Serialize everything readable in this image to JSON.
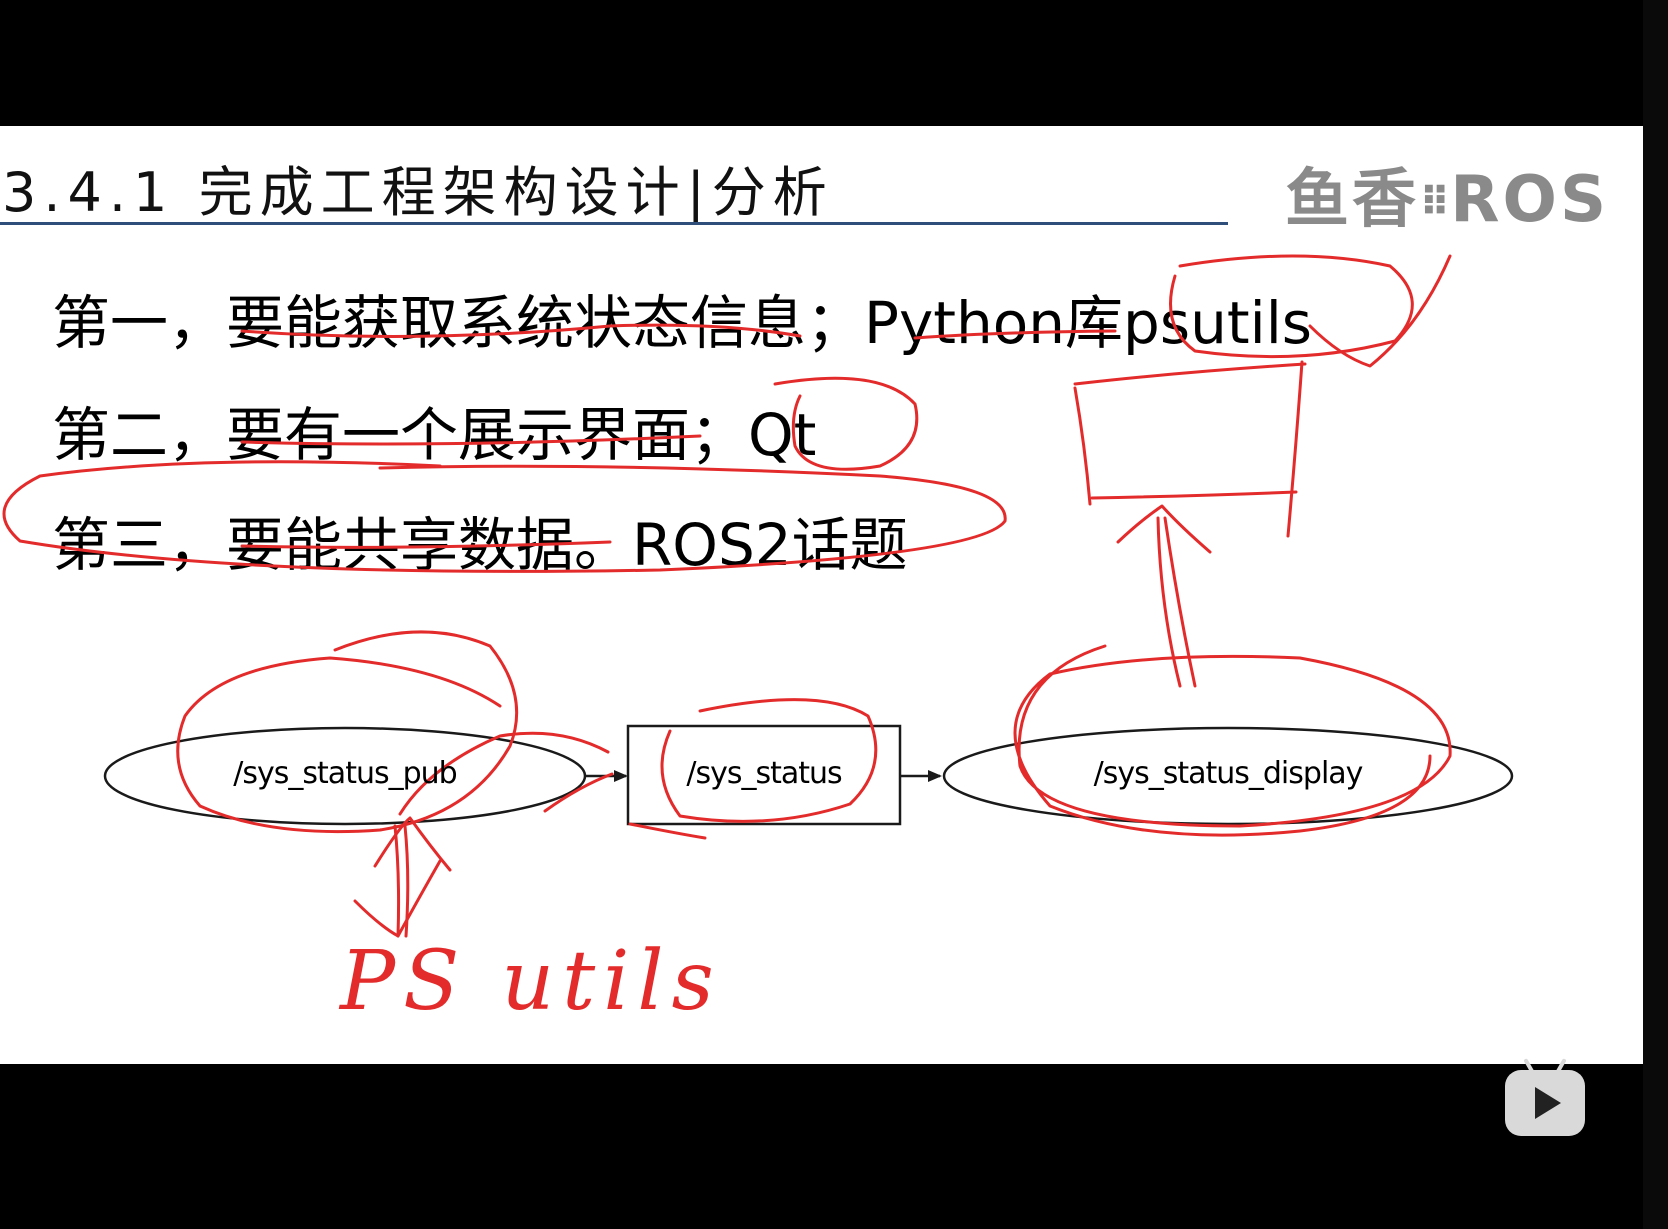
{
  "slide": {
    "title": "3.4.1 完成工程架构设计|分析",
    "logo_text": "鱼香",
    "logo_dots": "⠿",
    "logo_suffix": "ROS",
    "bullets": [
      "第一，要能获取系统状态信息；Python库psutils",
      "第二，要有一个展示界面；Qt",
      "第三，要能共享数据。ROS2话题"
    ]
  },
  "graph": {
    "publisher": "/sys_status_pub",
    "topic": "/sys_status",
    "subscriber": "/sys_status_display"
  },
  "annotation": {
    "handwritten": "PS utils"
  },
  "player": {
    "play_icon": "bilibili-tv-play-icon"
  },
  "colors": {
    "ink": "#e32b2b",
    "title_rule": "#2f4f7a",
    "background": "#000000",
    "slide": "#ffffff"
  }
}
